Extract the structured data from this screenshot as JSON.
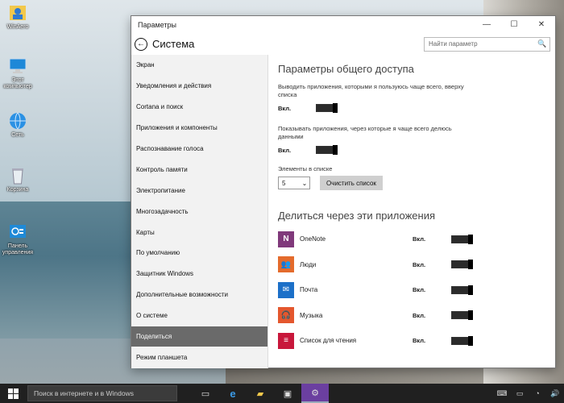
{
  "desktop": {
    "icons": [
      {
        "label": "WinAero",
        "icon": "user-folder-icon"
      },
      {
        "label": "Этот компьютер",
        "icon": "computer-icon"
      },
      {
        "label": "Сеть",
        "icon": "network-icon"
      },
      {
        "label": "Корзина",
        "icon": "recycle-bin-icon"
      },
      {
        "label": "Панель управления",
        "icon": "control-panel-icon"
      }
    ]
  },
  "window": {
    "title": "Параметры",
    "buttons": {
      "minimize": "—",
      "maximize": "☐",
      "close": "✕"
    },
    "header": {
      "back_icon": "←",
      "title": "Система"
    },
    "search": {
      "placeholder": "Найти параметр",
      "icon": "🔍"
    }
  },
  "nav": {
    "items": [
      {
        "label": "Экран",
        "active": false
      },
      {
        "label": "Уведомления и действия",
        "active": false
      },
      {
        "label": "Cortana и поиск",
        "active": false
      },
      {
        "label": "Приложения и компоненты",
        "active": false
      },
      {
        "label": "Распознавание голоса",
        "active": false
      },
      {
        "label": "Контроль памяти",
        "active": false
      },
      {
        "label": "Электропитание",
        "active": false
      },
      {
        "label": "Многозадачность",
        "active": false
      },
      {
        "label": "Карты",
        "active": false
      },
      {
        "label": "По умолчанию",
        "active": false
      },
      {
        "label": "Защитник Windows",
        "active": false
      },
      {
        "label": "Дополнительные возможности",
        "active": false
      },
      {
        "label": "О системе",
        "active": false
      },
      {
        "label": "Поделиться",
        "active": true
      },
      {
        "label": "Режим планшета",
        "active": false
      }
    ]
  },
  "content": {
    "section1_title": "Параметры общего доступа",
    "option1": {
      "desc": "Выводить приложения, которыми я пользуюсь чаще всего, вверху списка",
      "state": "Вкл."
    },
    "option2": {
      "desc": "Показывать приложения, через которые я чаще всего делюсь данными",
      "state": "Вкл."
    },
    "list_count": {
      "label": "Элементы в списке",
      "value": "5",
      "chevron": "⌄"
    },
    "clear_button": "Очистить список",
    "section2_title": "Делиться через эти приложения",
    "apps": [
      {
        "name": "OneNote",
        "state": "Вкл.",
        "color": "#80397b",
        "glyph": "N",
        "icon": "onenote-icon"
      },
      {
        "name": "Люди",
        "state": "Вкл.",
        "color": "#e46b2c",
        "glyph": "👥",
        "icon": "people-icon"
      },
      {
        "name": "Почта",
        "state": "Вкл.",
        "color": "#1c70c8",
        "glyph": "✉",
        "icon": "mail-icon"
      },
      {
        "name": "Музыка",
        "state": "Вкл.",
        "color": "#e4572e",
        "glyph": "🎧",
        "icon": "music-icon"
      },
      {
        "name": "Список для чтения",
        "state": "Вкл.",
        "color": "#c8173b",
        "glyph": "≡",
        "icon": "reading-list-icon"
      }
    ]
  },
  "taskbar": {
    "search_placeholder": "Поиск в интернете и в Windows",
    "apps": [
      {
        "icon": "task-view-icon",
        "glyph": "▭",
        "active": false
      },
      {
        "icon": "edge-icon",
        "glyph": "e",
        "active": false
      },
      {
        "icon": "file-explorer-icon",
        "glyph": "▰",
        "active": false
      },
      {
        "icon": "store-icon",
        "glyph": "▣",
        "active": false
      },
      {
        "icon": "settings-icon",
        "glyph": "⚙",
        "active": true
      }
    ],
    "tray": [
      "⌨",
      "▭",
      "◔",
      "🔊"
    ]
  }
}
